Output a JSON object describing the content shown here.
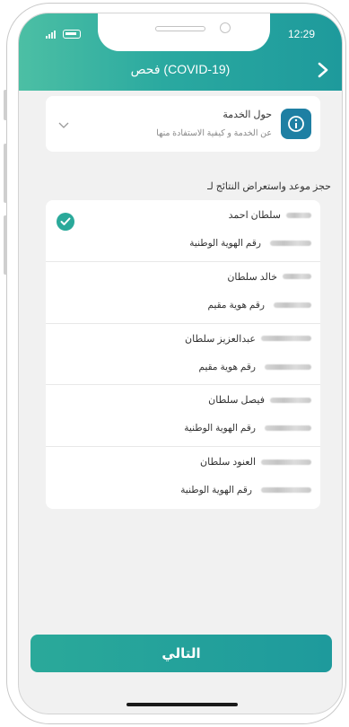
{
  "status_bar": {
    "time": "12:29"
  },
  "header": {
    "title": "فحص (COVID-19)"
  },
  "about": {
    "title": "حول الخدمة",
    "subtitle": "عن الخدمة و كيفية الاستفادة منها"
  },
  "section_label": "حجز موعد واستعراض النتائج لـ",
  "people": [
    {
      "name": "سلطان احمد",
      "id_label": "رقم الهوية الوطنية",
      "selected": true
    },
    {
      "name": "خالد سلطان",
      "id_label": "رقم هوية مقيم",
      "selected": false
    },
    {
      "name": "عبدالعزيز سلطان",
      "id_label": "رقم هوية مقيم",
      "selected": false
    },
    {
      "name": "فيصل سلطان",
      "id_label": "رقم الهوية الوطنية",
      "selected": false
    },
    {
      "name": "العنود سلطان",
      "id_label": "رقم الهوية الوطنية",
      "selected": false
    }
  ],
  "next_button": {
    "label": "التالي"
  },
  "colors": {
    "accent": "#2aa99a",
    "info": "#1e7fa3",
    "background": "#f1f1f1"
  },
  "icons": {
    "back": "chevron-right-icon",
    "info": "info-icon",
    "expand": "chevron-down-icon",
    "selected": "check-circle-icon"
  }
}
